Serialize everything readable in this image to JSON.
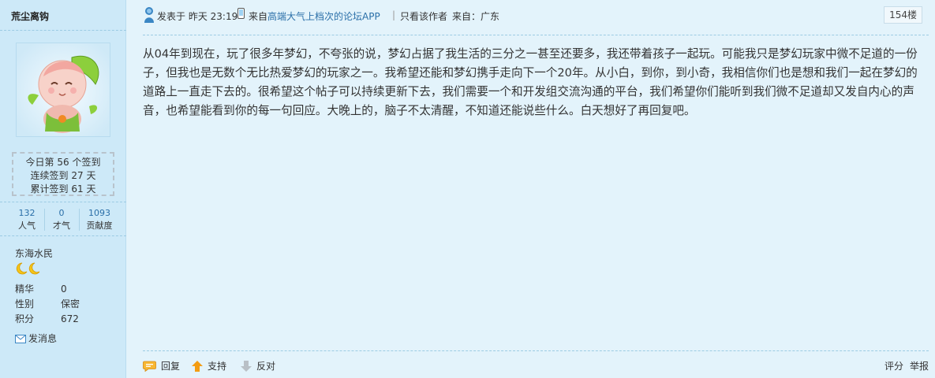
{
  "sidebar": {
    "author_name": "荒尘离钩",
    "signin": {
      "line1": "今日第 56 个签到",
      "line2": "连续签到 27 天",
      "line3": "累计签到 61 天"
    },
    "stats": [
      {
        "value": "132",
        "label": "人气"
      },
      {
        "value": "0",
        "label": "才气"
      },
      {
        "value": "1093",
        "label": "贡献度"
      }
    ],
    "rank": "东海水民",
    "info": [
      {
        "key": "精华",
        "value": "0"
      },
      {
        "key": "性别",
        "value": "保密"
      },
      {
        "key": "积分",
        "value": "672"
      }
    ],
    "send_message": "发消息"
  },
  "post": {
    "posted_label": "发表于 昨天 23:19",
    "app_text_pre": "来自",
    "app_link": "高端大气上档次的论坛APP",
    "author_only": "只看该作者",
    "from_label": "来自：广东",
    "floor": "154楼",
    "content": "从04年到现在，玩了很多年梦幻，不夸张的说，梦幻占据了我生活的三分之一甚至还要多，我还带着孩子一起玩。可能我只是梦幻玩家中微不足道的一份子，但我也是无数个无比热爱梦幻的玩家之一。我希望还能和梦幻携手走向下一个20年。从小白，到你，到小奇，我相信你们也是想和我们一起在梦幻的道路上一直走下去的。很希望这个帖子可以持续更新下去，我们需要一个和开发组交流沟通的平台，我们希望你们能听到我们微不足道却又发自内心的声音，也希望能看到你的每一句回应。大晚上的，脑子不太清醒，不知道还能说些什么。白天想好了再回复吧。"
  },
  "actions": {
    "reply": "回复",
    "support": "支持",
    "oppose": "反对",
    "rate": "评分",
    "report": "举报"
  },
  "colors": {
    "background": "#e3f3fb",
    "sidebar": "#cde9f8",
    "link": "#2a6fa8",
    "accent_orange": "#f39c12"
  }
}
